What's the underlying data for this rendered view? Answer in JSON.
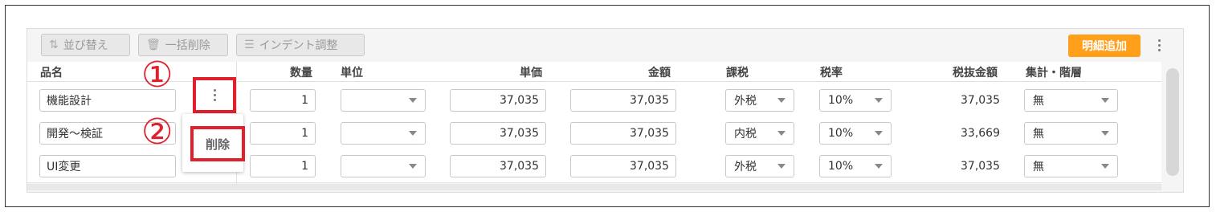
{
  "toolbar": {
    "sort_label": "並び替え",
    "bulk_delete_label": "一括削除",
    "indent_label": "インデント調整",
    "add_detail_label": "明細追加"
  },
  "columns": [
    "品名",
    "数量",
    "単位",
    "単価",
    "金額",
    "課税",
    "税率",
    "税抜金額",
    "集計・階層"
  ],
  "rows": [
    {
      "name": "機能設計",
      "qty": "1",
      "unit": "",
      "price": "37,035",
      "amount": "37,035",
      "tax": "外税",
      "rate": "10%",
      "net": "37,035",
      "agg": "無"
    },
    {
      "name": "開発～検証",
      "qty": "1",
      "unit": "",
      "price": "37,035",
      "amount": "37,035",
      "tax": "内税",
      "rate": "10%",
      "net": "33,669",
      "agg": "無"
    },
    {
      "name": "UI変更",
      "qty": "1",
      "unit": "",
      "price": "37,035",
      "amount": "37,035",
      "tax": "外税",
      "rate": "10%",
      "net": "37,035",
      "agg": "無"
    }
  ],
  "popup": {
    "delete_label": "削除"
  },
  "annotations": {
    "one": "①",
    "two": "②"
  },
  "colors": {
    "accent": "#ff9f1a",
    "highlight": "#e0202a"
  }
}
